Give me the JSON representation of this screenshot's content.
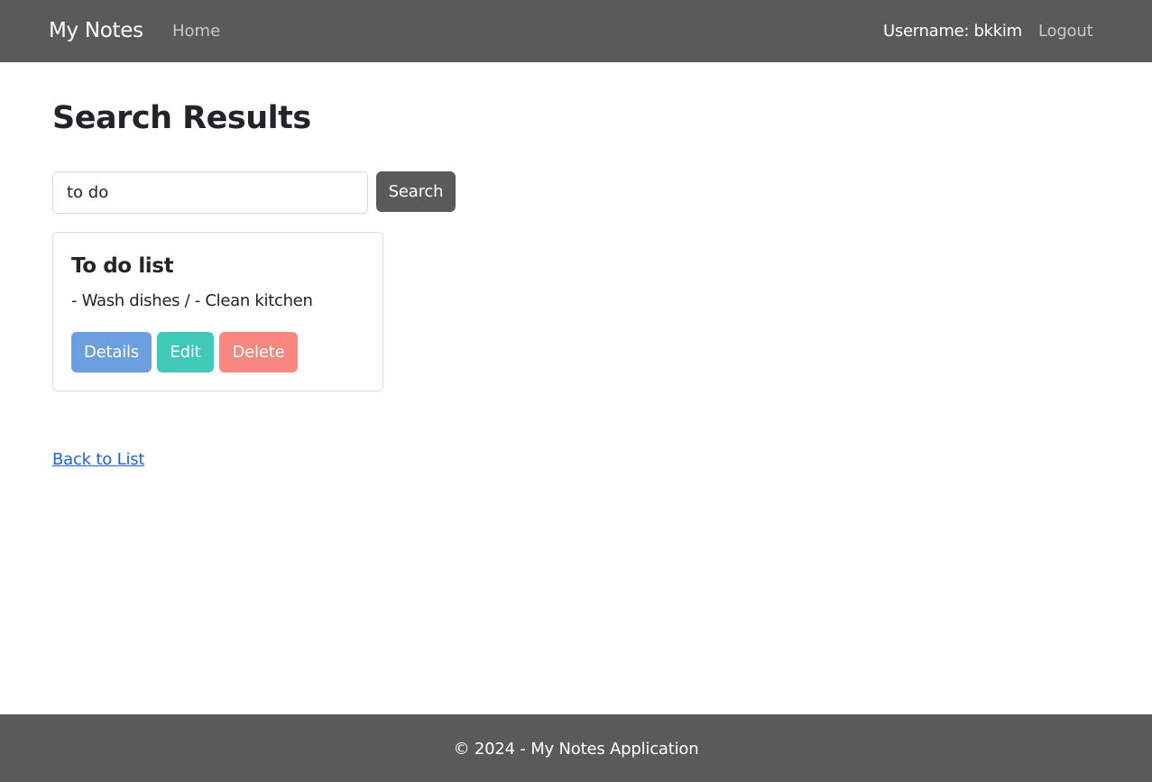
{
  "navbar": {
    "brand": "My Notes",
    "home_label": "Home",
    "user_text": "Username: bkkim",
    "logout_label": "Logout",
    "background_color": "#5a5a5a"
  },
  "main": {
    "title": "Search Results",
    "search": {
      "value": "to do",
      "button_label": "Search"
    },
    "notes": [
      {
        "title": "To do list",
        "content": "- Wash dishes / - Clean kitchen",
        "details_label": "Details",
        "edit_label": "Edit",
        "delete_label": "Delete"
      }
    ],
    "back_link_label": "Back to List"
  },
  "footer": {
    "text": "© 2024 - My Notes Application"
  },
  "colors": {
    "details_button": "#6b9fe0",
    "edit_button": "#40c8b8",
    "delete_button": "#f7877f",
    "link": "#1d63d6"
  }
}
